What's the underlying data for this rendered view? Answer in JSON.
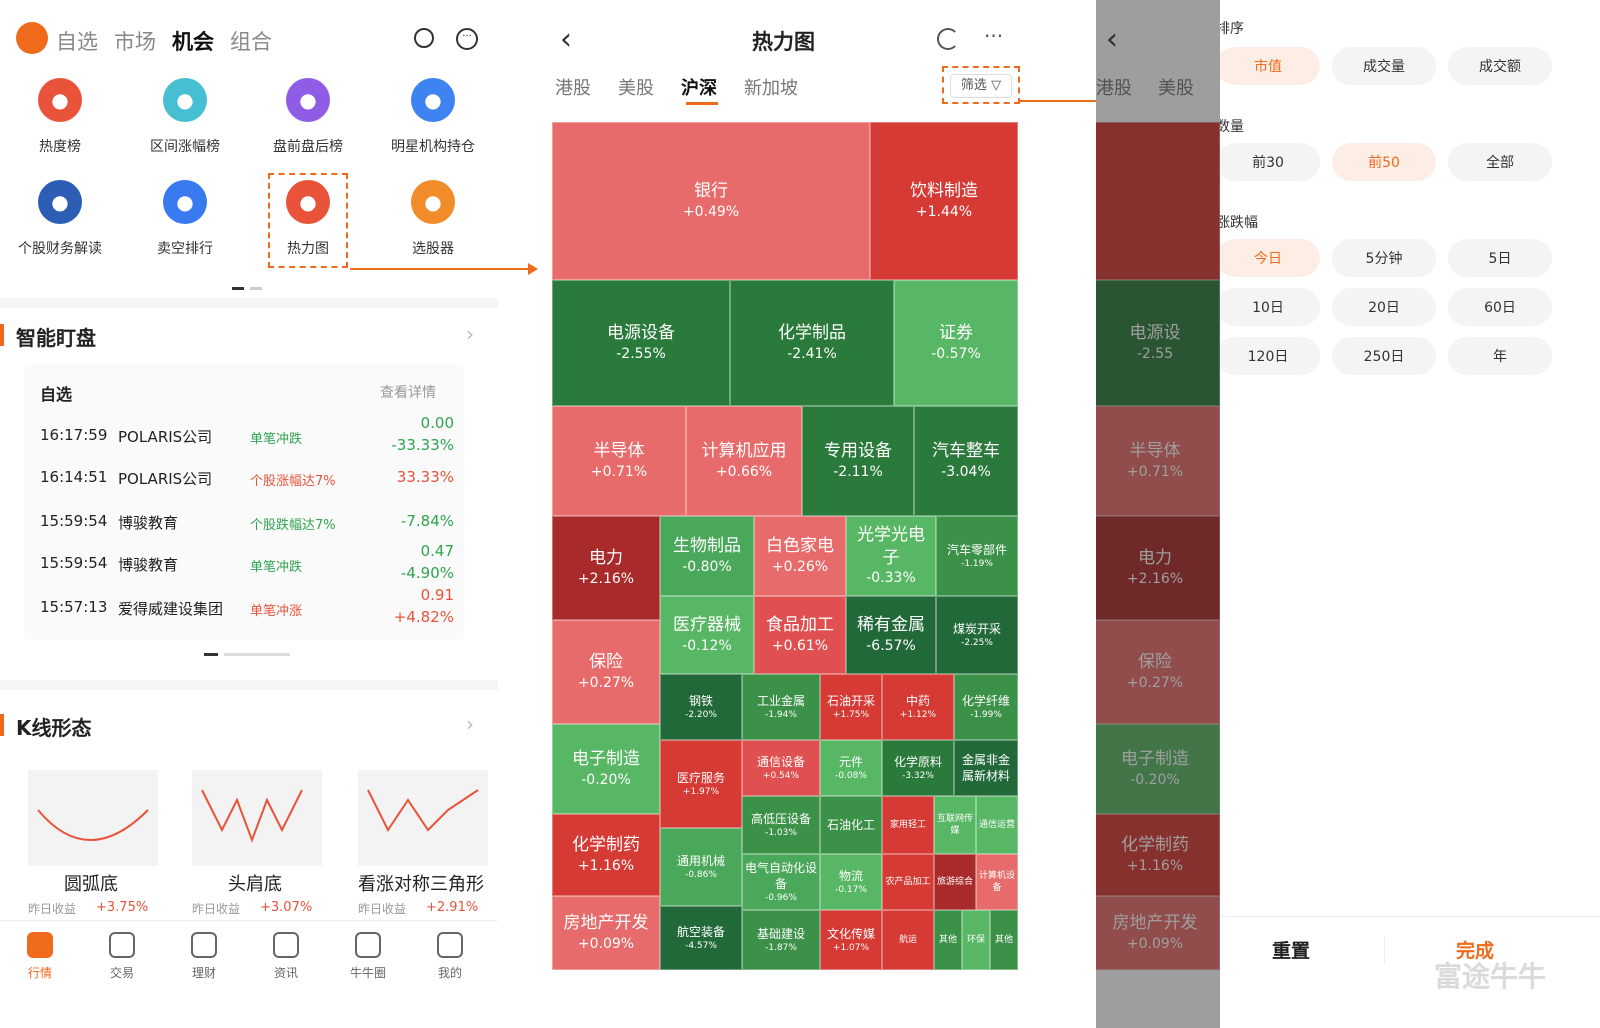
{
  "left": {
    "tabs": [
      "自选",
      "市场",
      "机会",
      "组合"
    ],
    "grid": [
      {
        "label": "热度榜",
        "color": "#e8533a",
        "icon": "fire-icon"
      },
      {
        "label": "区间涨幅榜",
        "color": "#46bfd2",
        "icon": "range-icon"
      },
      {
        "label": "盘前盘后榜",
        "color": "#8f5ce6",
        "icon": "clock-icon"
      },
      {
        "label": "明星机构持仓",
        "color": "#3e83f0",
        "icon": "crown-icon"
      },
      {
        "label": "个股财务解读",
        "color": "#2c5eb5",
        "icon": "book-icon"
      },
      {
        "label": "卖空排行",
        "color": "#3a7af0",
        "icon": "chart-down-icon"
      },
      {
        "label": "热力图",
        "color": "#e8533a",
        "icon": "heatmap-icon"
      },
      {
        "label": "选股器",
        "color": "#f28c2a",
        "icon": "filter-icon"
      }
    ],
    "smart": {
      "title": "智能盯盘",
      "sub": "自选",
      "detail": "查看详情",
      "rows": [
        {
          "time": "16:17:59",
          "name": "POLARIS公司",
          "tag": "单笔冲跌",
          "tagc": "#2ea44f",
          "v1": "0.00",
          "v1c": "#2ea44f",
          "v2": "-33.33%",
          "v2c": "#2ea44f"
        },
        {
          "time": "16:14:51",
          "name": "POLARIS公司",
          "tag": "个股涨幅达7%",
          "tagc": "#e8533a",
          "v1": "",
          "v1c": "#e8533a",
          "v2": "33.33%",
          "v2c": "#e8533a"
        },
        {
          "time": "15:59:54",
          "name": "博骏教育",
          "tag": "个股跌幅达7%",
          "tagc": "#2ea44f",
          "v1": "",
          "v1c": "#2ea44f",
          "v2": "-7.84%",
          "v2c": "#2ea44f"
        },
        {
          "time": "15:59:54",
          "name": "博骏教育",
          "tag": "单笔冲跌",
          "tagc": "#2ea44f",
          "v1": "0.47",
          "v1c": "#2ea44f",
          "v2": "-4.90%",
          "v2c": "#2ea44f"
        },
        {
          "time": "15:57:13",
          "name": "爱得威建设集团",
          "tag": "单笔冲涨",
          "tagc": "#e8533a",
          "v1": "0.91",
          "v1c": "#e8533a",
          "v2": "+4.82%",
          "v2c": "#e8533a"
        }
      ]
    },
    "kline": {
      "title": "K线形态",
      "cards": [
        {
          "name": "圆弧底",
          "label": "昨日收益",
          "val": "+3.75%"
        },
        {
          "name": "头肩底",
          "label": "昨日收益",
          "val": "+3.07%"
        },
        {
          "name": "看涨对称三角形",
          "label": "昨日收益",
          "val": "+2.91%"
        }
      ]
    },
    "nav": [
      {
        "label": "行情",
        "icon": "market-icon",
        "active": true
      },
      {
        "label": "交易",
        "icon": "trade-icon"
      },
      {
        "label": "理财",
        "icon": "wealth-icon"
      },
      {
        "label": "资讯",
        "icon": "news-icon"
      },
      {
        "label": "牛牛圈",
        "icon": "community-icon"
      },
      {
        "label": "我的",
        "icon": "profile-icon"
      }
    ]
  },
  "heatmap": {
    "title": "热力图",
    "tabs": [
      "港股",
      "美股",
      "沪深",
      "新加坡"
    ],
    "filter": "筛选",
    "cells": [
      {
        "n": "银行",
        "v": "+0.49%",
        "c": "#e86b6b"
      },
      {
        "n": "饮料制造",
        "v": "+1.44%",
        "c": "#d63a35"
      },
      {
        "n": "电源设备",
        "v": "-2.55%",
        "c": "#2a7a3b"
      },
      {
        "n": "化学制品",
        "v": "-2.41%",
        "c": "#2a7a3b"
      },
      {
        "n": "证券",
        "v": "-0.57%",
        "c": "#58b765"
      },
      {
        "n": "半导体",
        "v": "+0.71%",
        "c": "#e86b6b"
      },
      {
        "n": "计算机应用",
        "v": "+0.66%",
        "c": "#e86b6b"
      },
      {
        "n": "专用设备",
        "v": "-2.11%",
        "c": "#2a7a3b"
      },
      {
        "n": "汽车整车",
        "v": "-3.04%",
        "c": "#2a7a3b"
      },
      {
        "n": "电力",
        "v": "+2.16%",
        "c": "#a92a2a"
      },
      {
        "n": "生物制品",
        "v": "-0.80%",
        "c": "#4aa85a"
      },
      {
        "n": "白色家电",
        "v": "+0.26%",
        "c": "#e86b6b"
      },
      {
        "n": "光学光电子",
        "v": "-0.33%",
        "c": "#58b765"
      },
      {
        "n": "汽车零部件",
        "v": "-1.19%",
        "c": "#3b9148"
      },
      {
        "n": "医疗器械",
        "v": "-0.12%",
        "c": "#58b765"
      },
      {
        "n": "食品加工",
        "v": "+0.61%",
        "c": "#e15050"
      },
      {
        "n": "稀有金属",
        "v": "-6.57%",
        "c": "#22693a"
      },
      {
        "n": "煤炭开采",
        "v": "-2.25%",
        "c": "#22693a"
      },
      {
        "n": "保险",
        "v": "+0.27%",
        "c": "#e86b6b"
      },
      {
        "n": "钢铁",
        "v": "-2.20%",
        "c": "#22693a"
      },
      {
        "n": "工业金属",
        "v": "-1.94%",
        "c": "#3b9148"
      },
      {
        "n": "石油开采",
        "v": "+1.75%",
        "c": "#d63a35"
      },
      {
        "n": "中药",
        "v": "+1.12%",
        "c": "#d63a35"
      },
      {
        "n": "化学纤维",
        "v": "-1.99%",
        "c": "#3b9148"
      },
      {
        "n": "电子制造",
        "v": "-0.20%",
        "c": "#58b765"
      },
      {
        "n": "通信设备",
        "v": "+0.54%",
        "c": "#e15050"
      },
      {
        "n": "元件",
        "v": "-0.08%",
        "c": "#58b765"
      },
      {
        "n": "化学原料",
        "v": "-3.32%",
        "c": "#2a7a3b"
      },
      {
        "n": "金属非金属新材料",
        "v": "",
        "c": "#22693a"
      },
      {
        "n": "医疗服务",
        "v": "+1.97%",
        "c": "#d63a35"
      },
      {
        "n": "高低压设备",
        "v": "-1.03%",
        "c": "#3b9148"
      },
      {
        "n": "石油化工",
        "v": "",
        "c": "#3b9148"
      },
      {
        "n": "家用轻工",
        "v": "",
        "c": "#d63a35"
      },
      {
        "n": "互联网传媒",
        "v": "",
        "c": "#58b765"
      },
      {
        "n": "通信运营",
        "v": "",
        "c": "#58b765"
      },
      {
        "n": "化学制药",
        "v": "+1.16%",
        "c": "#d63a35"
      },
      {
        "n": "通用机械",
        "v": "-0.86%",
        "c": "#4aa85a"
      },
      {
        "n": "电气自动化设备",
        "v": "-0.96%",
        "c": "#4aa85a"
      },
      {
        "n": "物流",
        "v": "-0.17%",
        "c": "#58b765"
      },
      {
        "n": "农产品加工",
        "v": "",
        "c": "#d63a35"
      },
      {
        "n": "旅游综合",
        "v": "",
        "c": "#a92a2a"
      },
      {
        "n": "计算机设备",
        "v": "",
        "c": "#e86b6b"
      },
      {
        "n": "房地产开发",
        "v": "+0.09%",
        "c": "#e86b6b"
      },
      {
        "n": "航空装备",
        "v": "-4.57%",
        "c": "#22693a"
      },
      {
        "n": "基础建设",
        "v": "-1.87%",
        "c": "#3b9148"
      },
      {
        "n": "文化传媒",
        "v": "+1.07%",
        "c": "#d63a35"
      },
      {
        "n": "航运",
        "v": "",
        "c": "#d63a35"
      },
      {
        "n": "其他",
        "v": "",
        "c": "#3b9148"
      },
      {
        "n": "环保",
        "v": "",
        "c": "#58b765"
      },
      {
        "n": "其他",
        "v": "",
        "c": "#3b9148"
      }
    ]
  },
  "mini": {
    "tabs": [
      "港股",
      "美股"
    ],
    "cells": [
      {
        "n": "",
        "v": ""
      },
      {
        "n": "电源设",
        "v": "-2.55"
      },
      {
        "n": "半导体",
        "v": "+0.71%"
      },
      {
        "n": "电力",
        "v": "+2.16%"
      },
      {
        "n": "保险",
        "v": "+0.27%"
      },
      {
        "n": "电子制造",
        "v": "-0.20%"
      },
      {
        "n": "化学制药",
        "v": "+1.16%"
      },
      {
        "n": "房地产开发",
        "v": "+0.09%"
      }
    ]
  },
  "panel": {
    "sort_title": "排序",
    "sort": [
      "市值",
      "成交量",
      "成交额"
    ],
    "count_title": "数量",
    "count": [
      "前30",
      "前50",
      "全部"
    ],
    "change_title": "涨跌幅",
    "change": [
      "今日",
      "5分钟",
      "5日",
      "10日",
      "20日",
      "60日",
      "120日",
      "250日",
      "年"
    ],
    "reset": "重置",
    "done": "完成",
    "watermark": "富途牛牛"
  }
}
